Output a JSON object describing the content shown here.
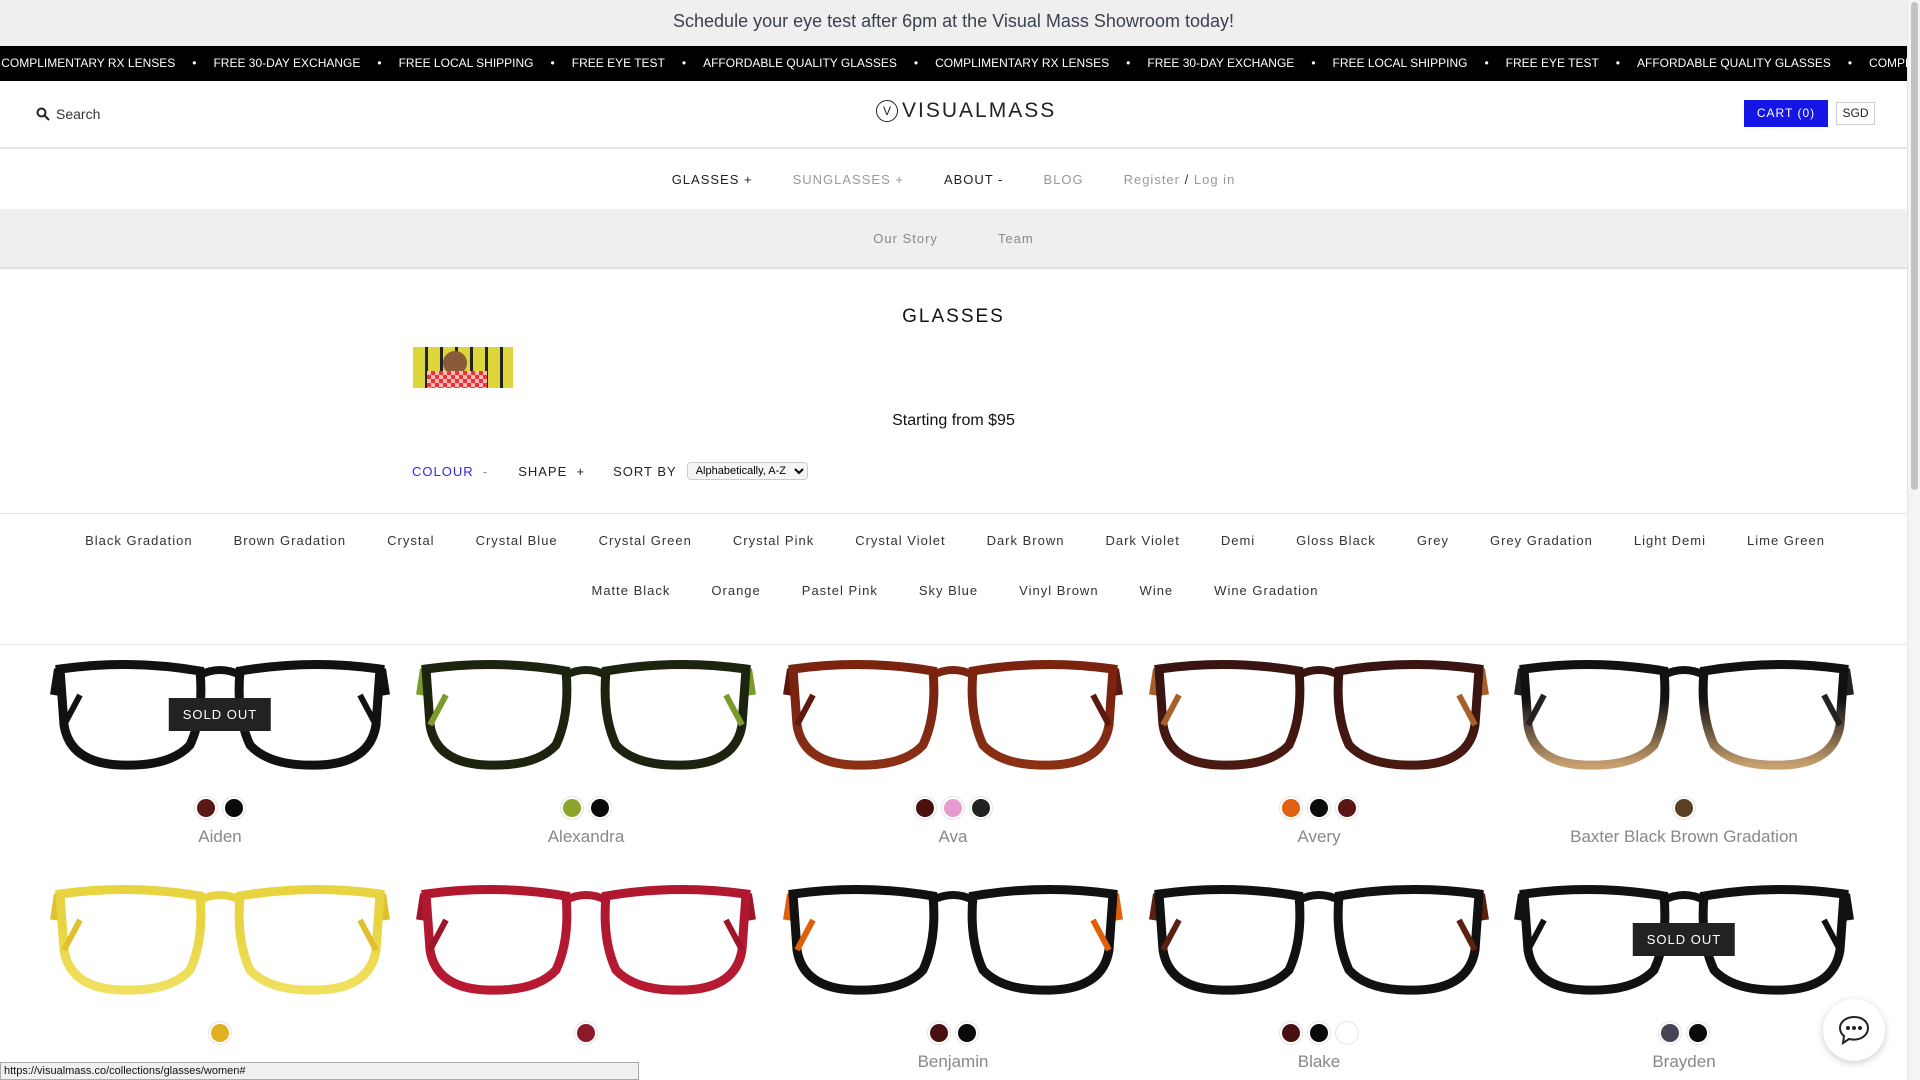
{
  "promo": "Schedule your eye test after 6pm at the Visual Mass Showroom today!",
  "ticker": [
    "COMPLIMENTARY RX LENSES",
    "FREE 30-DAY EXCHANGE",
    "FREE LOCAL SHIPPING",
    "FREE EYE TEST",
    "AFFORDABLE QUALITY GLASSES"
  ],
  "header": {
    "search": "Search",
    "logo": "VISUALMASS",
    "cart": "CART (0)",
    "currency": "SGD"
  },
  "nav": {
    "glasses": "GLASSES +",
    "sunglasses": "SUNGLASSES +",
    "about": "ABOUT -",
    "blog": "BLOG",
    "register": "Register",
    "sep": "/",
    "login": "Log in"
  },
  "subnav": [
    "Our Story",
    "Team"
  ],
  "page": {
    "title": "GLASSES",
    "starting": "Starting from $95"
  },
  "filters": {
    "colour": "COLOUR",
    "colour_toggle": "-",
    "shape": "SHAPE",
    "shape_toggle": "+",
    "sort_label": "SORT BY",
    "sort_value": "Alphabetically, A-Z"
  },
  "colours": [
    "Black Gradation",
    "Brown Gradation",
    "Crystal",
    "Crystal Blue",
    "Crystal Green",
    "Crystal Pink",
    "Crystal Violet",
    "Dark Brown",
    "Dark Violet",
    "Demi",
    "Gloss Black",
    "Grey",
    "Grey Gradation",
    "Light Demi",
    "Lime Green",
    "Matte Black",
    "Orange",
    "Pastel Pink",
    "Sky Blue",
    "Vinyl Brown",
    "Wine",
    "Wine Gradation"
  ],
  "sold_out": "SOLD OUT",
  "products": [
    {
      "name": "Aiden",
      "sold_out": true,
      "frame": "#111111",
      "temple": "#111111",
      "bottom": "#111111",
      "swatches": [
        "#5a1818",
        "#0a0a0a"
      ]
    },
    {
      "name": "Alexandra",
      "sold_out": false,
      "frame": "#1c2410",
      "temple": "#7a9a2a",
      "bottom": "#1c2410",
      "swatches": [
        "#8aa52a",
        "#0a0a0a"
      ]
    },
    {
      "name": "Ava",
      "sold_out": false,
      "frame": "#7a2410",
      "temple": "#5a1a10",
      "bottom": "#8a3015",
      "swatches": [
        "#4a1010",
        "#e59ad0",
        "#222222"
      ]
    },
    {
      "name": "Avery",
      "sold_out": false,
      "frame": "#3a1410",
      "temple": "#a8602a",
      "bottom": "#4a1a12",
      "swatches": [
        "#e06010",
        "#0a0a0a",
        "#5a1515"
      ]
    },
    {
      "name": "Baxter Black Brown Gradation",
      "sold_out": false,
      "frame": "#111111",
      "temple": "#222222",
      "bottom": "#c8a070",
      "swatches": [
        "#5a4020"
      ]
    },
    {
      "name": "",
      "sold_out": false,
      "frame": "#e8d440",
      "temple": "#e0c030",
      "bottom": "#f0e060",
      "swatches": [
        "#e0b020"
      ]
    },
    {
      "name": "",
      "sold_out": false,
      "frame": "#b01830",
      "temple": "#a01428",
      "bottom": "#b81a32",
      "swatches": [
        "#8a1a2a"
      ]
    },
    {
      "name": "Benjamin",
      "sold_out": false,
      "frame": "#111111",
      "temple": "#e0600a",
      "bottom": "#111111",
      "swatches": [
        "#4a1010",
        "#0a0a0a"
      ]
    },
    {
      "name": "Blake",
      "sold_out": false,
      "frame": "#111111",
      "temple": "#5a2010",
      "bottom": "#111111",
      "swatches": [
        "#4a1010",
        "#0a0a0a",
        "#ffffff"
      ]
    },
    {
      "name": "Brayden",
      "sold_out": true,
      "frame": "#111111",
      "temple": "#111111",
      "bottom": "#111111",
      "swatches": [
        "#444455",
        "#0a0a0a"
      ]
    }
  ],
  "status_url": "https://visualmass.co/collections/glasses/women#",
  "colors": {
    "accent": "#1515e6",
    "promo_bg": "#efefef",
    "ticker_bg": "#000000"
  }
}
